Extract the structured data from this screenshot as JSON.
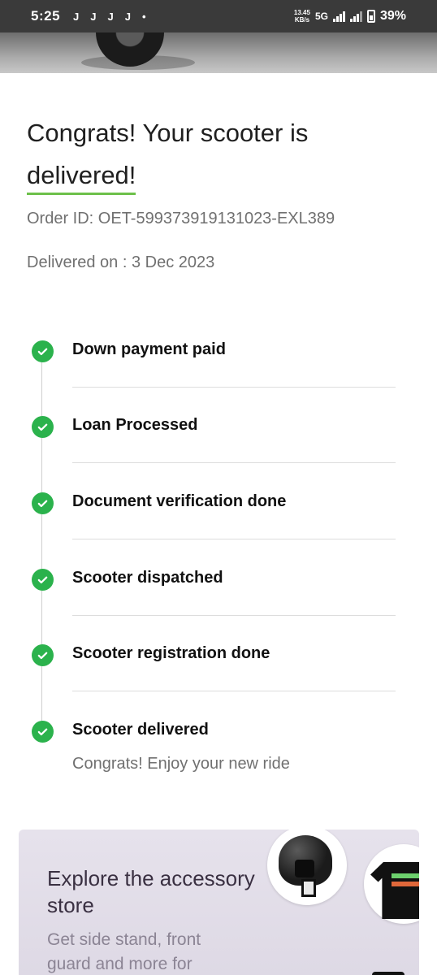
{
  "status_bar": {
    "time": "5:25",
    "notifications": [
      "J",
      "J",
      "J",
      "J",
      "•"
    ],
    "speed_value": "13.45",
    "speed_unit": "KB/s",
    "network": "5G",
    "battery_percent": "39%"
  },
  "header": {
    "title_prefix": "Congrats! Your scooter is",
    "title_highlight": "delivered!",
    "accent_color": "#6dc04a"
  },
  "order": {
    "order_id": "Order ID: OET-599373919131023-EXL389",
    "delivered_on": "Delivered on : 3 Dec 2023"
  },
  "timeline": {
    "check_color": "#2bb24c",
    "steps": [
      {
        "label": "Down payment paid",
        "icon": "check-icon"
      },
      {
        "label": "Loan Processed",
        "icon": "check-icon"
      },
      {
        "label": "Document verification done",
        "icon": "check-icon"
      },
      {
        "label": "Scooter dispatched",
        "icon": "check-icon"
      },
      {
        "label": "Scooter registration done",
        "icon": "check-icon"
      },
      {
        "label": "Scooter delivered",
        "icon": "check-icon",
        "subtext": "Congrats! Enjoy your new ride"
      }
    ]
  },
  "accessory_card": {
    "title": "Explore the accessory store",
    "subtitle": "Get side stand, front guard and more for"
  }
}
